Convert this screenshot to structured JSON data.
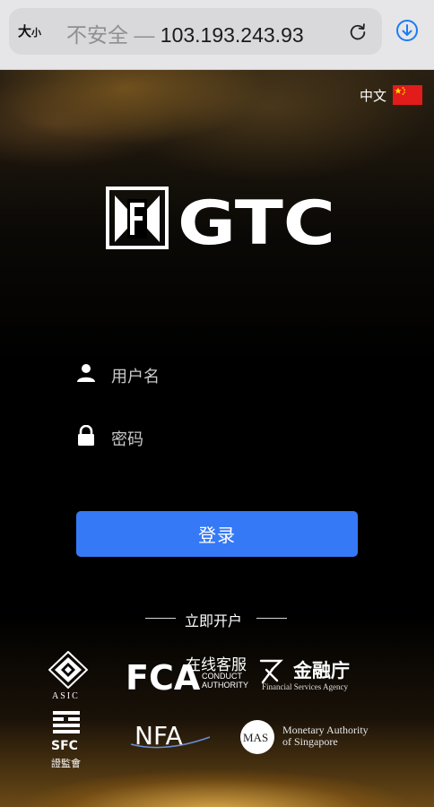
{
  "browser": {
    "reader_label_big": "大",
    "reader_label_small": "小",
    "url_insecure_label": "不安全 —",
    "url_host": "103.193.243.93"
  },
  "language": {
    "label": "中文",
    "flag": "china-flag-icon"
  },
  "logo": {
    "text": "GTC"
  },
  "login_form": {
    "username_placeholder": "用户名",
    "password_placeholder": "密码",
    "submit_label": "登录"
  },
  "open_account_label": "立即开户",
  "online_service_label": "在线客服",
  "regulators": {
    "asic": "ASIC",
    "fca_main": "FCA",
    "fca_line1": "CONDUCT",
    "fca_line2": "AUTHORITY",
    "fsa_main": "金融庁",
    "fsa_sub": "Financial Services Agency",
    "sfc_main": "SFC",
    "sfc_sub": "證監會",
    "nfa": "NFA",
    "mas_abbr": "MAS",
    "mas_line1": "Monetary Authority",
    "mas_line2": "of Singapore"
  },
  "colors": {
    "primary_button": "#3579f6",
    "browser_bar": "#e6e6e8",
    "download_blue": "#1a7cf5"
  }
}
